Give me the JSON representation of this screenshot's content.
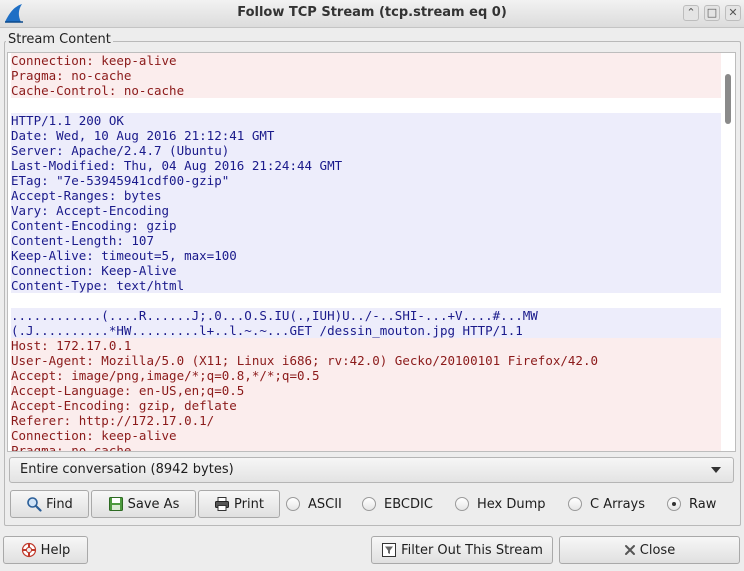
{
  "window": {
    "title": "Follow TCP Stream (tcp.stream eq 0)",
    "min_glyph": "⌃",
    "max_glyph": "□",
    "close_glyph": "✕"
  },
  "frame": {
    "label": "Stream Content"
  },
  "stream_lines": [
    {
      "text": "Connection: keep-alive",
      "dir": "client"
    },
    {
      "text": "Pragma: no-cache",
      "dir": "client"
    },
    {
      "text": "Cache-Control: no-cache",
      "dir": "client"
    },
    {
      "text": "",
      "dir": "blank"
    },
    {
      "text": "HTTP/1.1 200 OK",
      "dir": "server"
    },
    {
      "text": "Date: Wed, 10 Aug 2016 21:12:41 GMT",
      "dir": "server"
    },
    {
      "text": "Server: Apache/2.4.7 (Ubuntu)",
      "dir": "server"
    },
    {
      "text": "Last-Modified: Thu, 04 Aug 2016 21:24:44 GMT",
      "dir": "server"
    },
    {
      "text": "ETag: \"7e-53945941cdf00-gzip\"",
      "dir": "server"
    },
    {
      "text": "Accept-Ranges: bytes",
      "dir": "server"
    },
    {
      "text": "Vary: Accept-Encoding",
      "dir": "server"
    },
    {
      "text": "Content-Encoding: gzip",
      "dir": "server"
    },
    {
      "text": "Content-Length: 107",
      "dir": "server"
    },
    {
      "text": "Keep-Alive: timeout=5, max=100",
      "dir": "server"
    },
    {
      "text": "Connection: Keep-Alive",
      "dir": "server"
    },
    {
      "text": "Content-Type: text/html",
      "dir": "server"
    },
    {
      "text": "",
      "dir": "blank"
    },
    {
      "text": "............(....R......J;.0...O.S.IU(.,IUH)U../-..SHI-...+V....#...MW",
      "dir": "server"
    },
    {
      "text": "(.J..........*HW.........l+..l.~.~...GET /dessin_mouton.jpg HTTP/1.1",
      "dir": "server"
    },
    {
      "text": "Host: 172.17.0.1",
      "dir": "client"
    },
    {
      "text": "User-Agent: Mozilla/5.0 (X11; Linux i686; rv:42.0) Gecko/20100101 Firefox/42.0",
      "dir": "client"
    },
    {
      "text": "Accept: image/png,image/*;q=0.8,*/*;q=0.5",
      "dir": "client"
    },
    {
      "text": "Accept-Language: en-US,en;q=0.5",
      "dir": "client"
    },
    {
      "text": "Accept-Encoding: gzip, deflate",
      "dir": "client"
    },
    {
      "text": "Referer: http://172.17.0.1/",
      "dir": "client"
    },
    {
      "text": "Connection: keep-alive",
      "dir": "client"
    },
    {
      "text": "Pragma: no-cache",
      "dir": "client"
    }
  ],
  "colors": {
    "client_text": "#8b1a1a",
    "client_bg": "#fbeded",
    "server_text": "#1a1a8b",
    "server_bg": "#ededfb"
  },
  "conversation_select": {
    "value": "Entire conversation (8942 bytes)"
  },
  "toolbar": {
    "find_label": "Find",
    "save_as_label": "Save As",
    "print_label": "Print"
  },
  "format_options": [
    {
      "label": "ASCII",
      "checked": false
    },
    {
      "label": "EBCDIC",
      "checked": false
    },
    {
      "label": "Hex Dump",
      "checked": false
    },
    {
      "label": "C Arrays",
      "checked": false
    },
    {
      "label": "Raw",
      "checked": true
    }
  ],
  "footer": {
    "help_label": "Help",
    "filter_label": "Filter Out This Stream",
    "close_label": "Close"
  },
  "icons": {
    "app": "wireshark-fin-icon",
    "find": "magnifier-icon",
    "save_as": "save-icon",
    "print": "printer-icon",
    "help": "lifebuoy-icon",
    "filter": "filter-icon",
    "close": "close-icon"
  }
}
